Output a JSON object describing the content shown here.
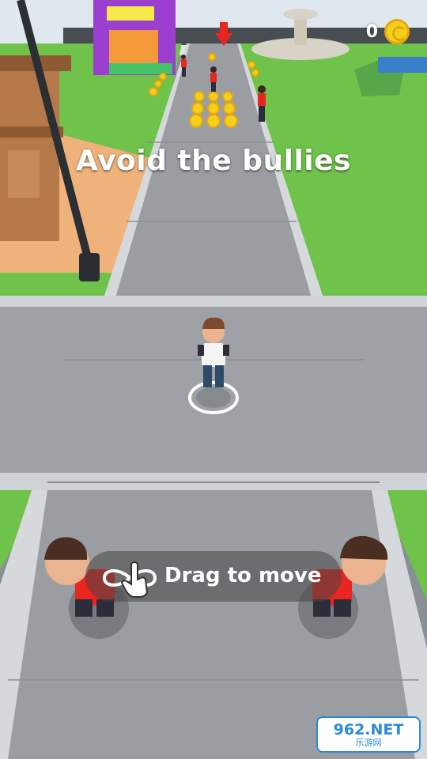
{
  "hud": {
    "coin_count": "0",
    "icons": {
      "coin": "coin-icon",
      "hand": "tap-hand-icon"
    }
  },
  "tutorial": {
    "instruction": "Avoid the bullies",
    "hint": "Drag to move"
  },
  "watermark": {
    "site_number": "962",
    "site_domain": ".NET",
    "site_name": "乐游网"
  },
  "colors": {
    "grass": "#6fc24a",
    "sidewalk": "#9a9ea3",
    "coin": "#f4cf1c",
    "bully_shirt": "#e8261f",
    "player_shirt": "#f4f4f4",
    "bouncy_castle": "#9b3fd1",
    "sand": "#efb27a"
  }
}
